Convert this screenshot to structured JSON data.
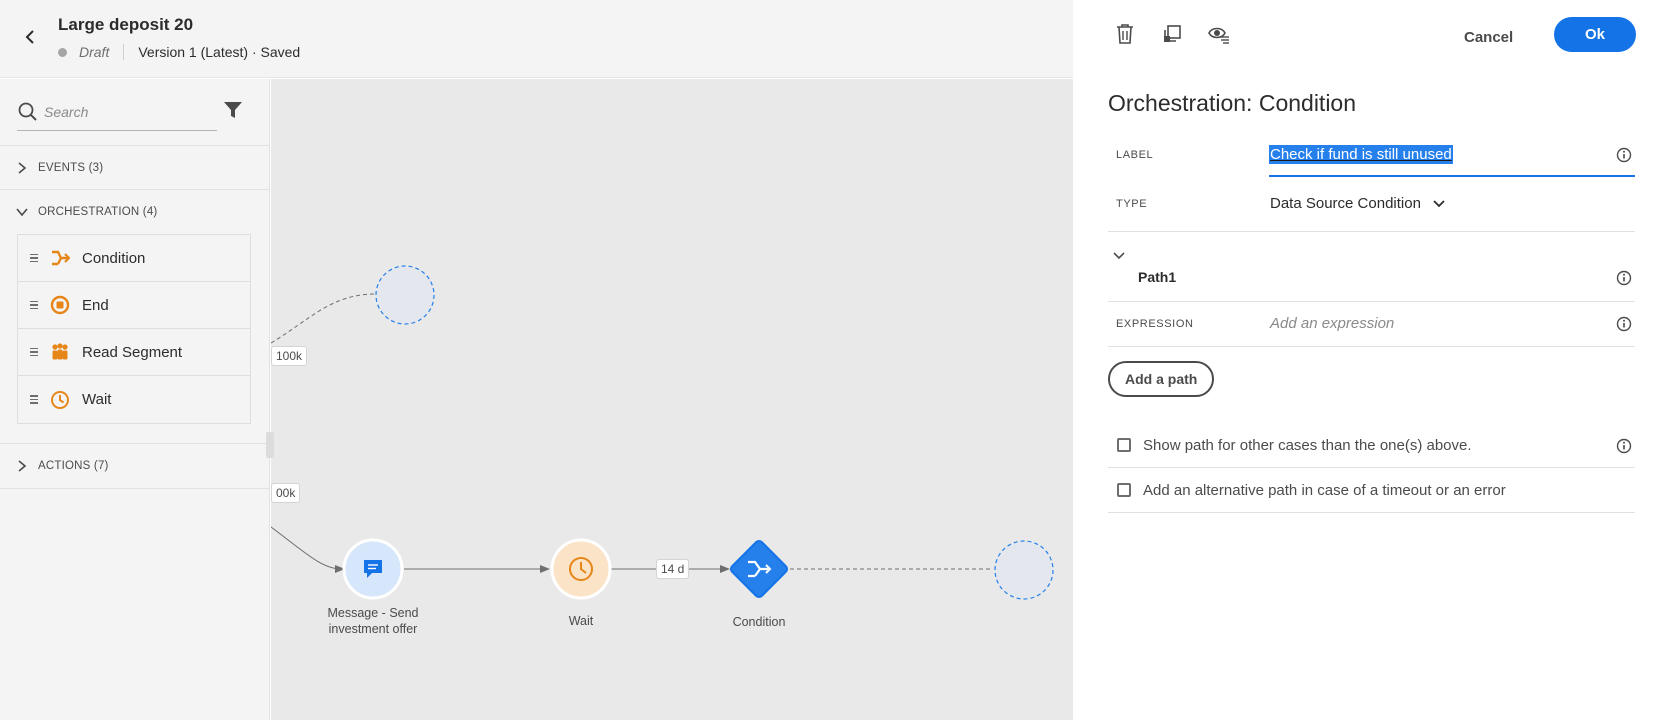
{
  "header": {
    "title": "Large deposit 20",
    "status": "Draft",
    "version": "Version 1 (Latest) · Saved"
  },
  "sidebar": {
    "search_placeholder": "Search",
    "sections": {
      "events": "EVENTS (3)",
      "orchestration": "ORCHESTRATION (4)",
      "actions": "ACTIONS (7)"
    },
    "orchestration_items": [
      {
        "label": "Condition",
        "icon": "condition-icon"
      },
      {
        "label": "End",
        "icon": "end-icon"
      },
      {
        "label": "Read Segment",
        "icon": "read-segment-icon"
      },
      {
        "label": "Wait",
        "icon": "wait-icon"
      }
    ]
  },
  "canvas": {
    "nodes": [
      {
        "label": "Message - Send investment offer",
        "line1": "Message - Send",
        "line2": "investment offer",
        "icon": "message-icon"
      },
      {
        "label": "Wait",
        "icon": "wait-icon"
      },
      {
        "label": "Condition",
        "icon": "condition-icon"
      }
    ],
    "edge_labels": {
      "upper": "100k",
      "lower": "00k",
      "wait_duration": "14 d"
    }
  },
  "panel": {
    "tools": [
      "trash-icon",
      "duplicate-icon",
      "hide-icon"
    ],
    "cancel_label": "Cancel",
    "ok_label": "Ok",
    "title": "Orchestration: Condition",
    "label_field": {
      "label": "LABEL",
      "value": "Check if fund is still unused"
    },
    "type_field": {
      "label": "TYPE",
      "value": "Data Source Condition"
    },
    "path": {
      "name": "Path1",
      "expression_label": "EXPRESSION",
      "expression_placeholder": "Add an expression"
    },
    "add_path_label": "Add a path",
    "checkboxes": [
      {
        "label": "Show path for other cases than the one(s) above.",
        "checked": false
      },
      {
        "label": "Add an alternative path in case of a timeout or an error",
        "checked": false
      }
    ]
  },
  "colors": {
    "accent": "#1473e6",
    "orchestration_orange": "#e68619",
    "canvas_bg": "#e9e9e9"
  }
}
